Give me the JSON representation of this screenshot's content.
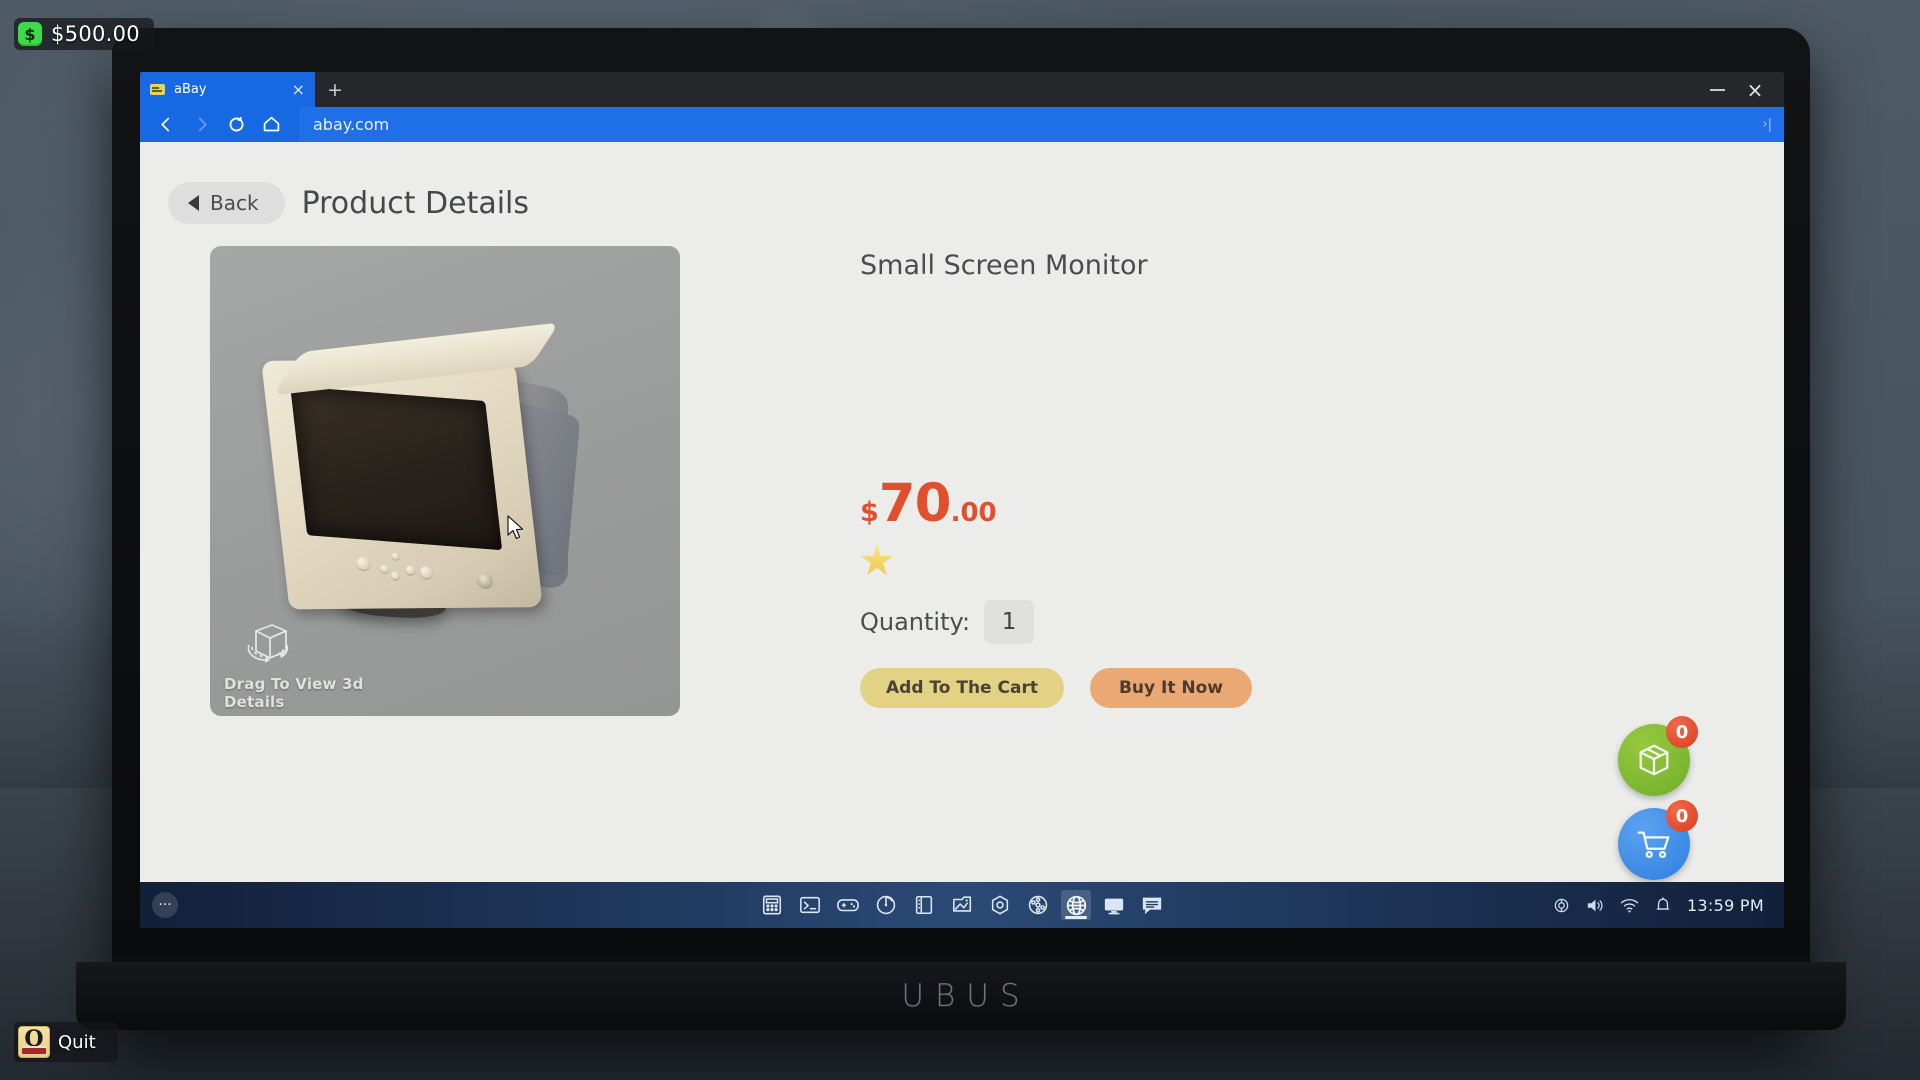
{
  "hud": {
    "currency_icon": "dollar-chip-icon",
    "money": "$500.00",
    "dollar_sign": "$"
  },
  "quit": {
    "label": "Quit",
    "icon": "quit-book-icon",
    "glyph": "Q"
  },
  "laptop": {
    "brand": "UBUS"
  },
  "browser": {
    "tab": {
      "title": "aBay",
      "favicon": "abay-favicon",
      "close_glyph": "×"
    },
    "new_tab_glyph": "+",
    "window_controls": {
      "minimize": "minimize-icon",
      "close_glyph": "×"
    },
    "nav": {
      "back": "back-arrow-icon",
      "forward": "forward-arrow-icon",
      "reload": "reload-icon",
      "home": "home-icon"
    },
    "url": "abay.com",
    "url_chevron": "›|"
  },
  "page": {
    "back_button_label": "Back",
    "title": "Product Details",
    "product": {
      "name": "Small Screen Monitor",
      "image_alt": "crt-monitor-3d-model",
      "drag_hint": "Drag To View 3d Details",
      "drag_hint_icon": "rotate-cube-icon",
      "price": {
        "currency": "$",
        "whole": "70",
        "cents": ".00",
        "color": "#e1502e"
      },
      "rating_stars": 1,
      "quantity_label": "Quantity:",
      "quantity_value": "1"
    },
    "actions": {
      "add_to_cart": "Add To The Cart",
      "buy_it_now": "Buy It Now",
      "add_to_cart_color": "#e3d284",
      "buy_it_now_color": "#eaa874"
    },
    "side_buttons": [
      {
        "name": "package-button",
        "icon": "package-box-icon",
        "count": "0",
        "color": "#7cba2f"
      },
      {
        "name": "cart-button",
        "icon": "shopping-cart-icon",
        "count": "0",
        "color": "#2b7fe0"
      }
    ]
  },
  "taskbar": {
    "start_glyph": "···",
    "icons": [
      "calculator-icon",
      "terminal-icon",
      "gamepad-icon",
      "disk-usage-icon",
      "notebook-icon",
      "photo-editor-icon",
      "settings-hex-icon",
      "film-reel-icon",
      "browser-globe-icon",
      "display-icon",
      "chat-icon"
    ],
    "active_icon": "browser-globe-icon",
    "tray": [
      "system-disc-icon",
      "volume-icon",
      "wifi-icon",
      "notifications-bell-icon"
    ],
    "clock": "13:59 PM"
  }
}
